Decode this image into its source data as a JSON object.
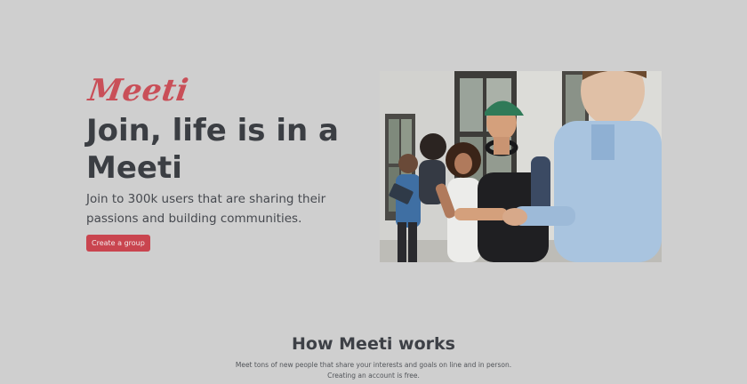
{
  "hero": {
    "brand": "Meeti",
    "headline": "Join, life is in a Meeti",
    "subtitle": "Join to 300k users that are sharing their passions and building communities.",
    "cta_label": "Create a group",
    "photo_icon": "people-shaking-hands-photo"
  },
  "how": {
    "title": "How Meeti works",
    "text": "Meet tons of new people that share your interests and goals on line and in person. Creating an account is free."
  },
  "colors": {
    "background": "#cfcfcf",
    "brand": "#c94f58",
    "button": "#c9454f",
    "heading": "#3b3e43"
  }
}
